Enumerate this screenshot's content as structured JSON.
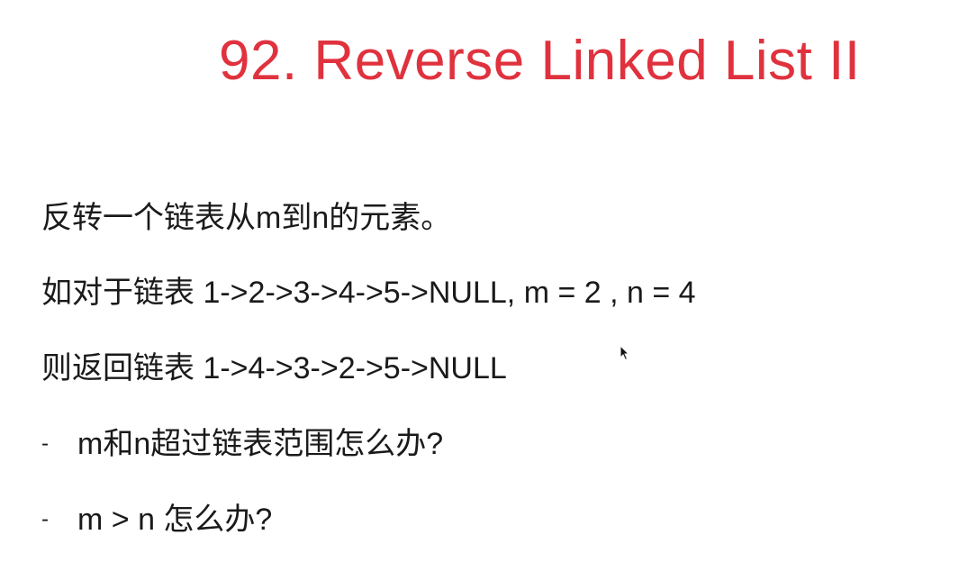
{
  "slide": {
    "title": "92. Reverse Linked List II",
    "lines": [
      "反转一个链表从m到n的元素。",
      "如对于链表 1->2->3->4->5->NULL, m = 2 , n = 4",
      "则返回链表 1->4->3->2->5->NULL"
    ],
    "bullets": [
      {
        "marker": "-",
        "text": "m和n超过链表范围怎么办?"
      },
      {
        "marker": "-",
        "text": "m > n 怎么办?"
      }
    ]
  },
  "colors": {
    "title": "#e0323e",
    "text": "#1a1a1a",
    "background": "#ffffff"
  },
  "icons": {
    "cursor": "mouse-pointer-icon"
  }
}
